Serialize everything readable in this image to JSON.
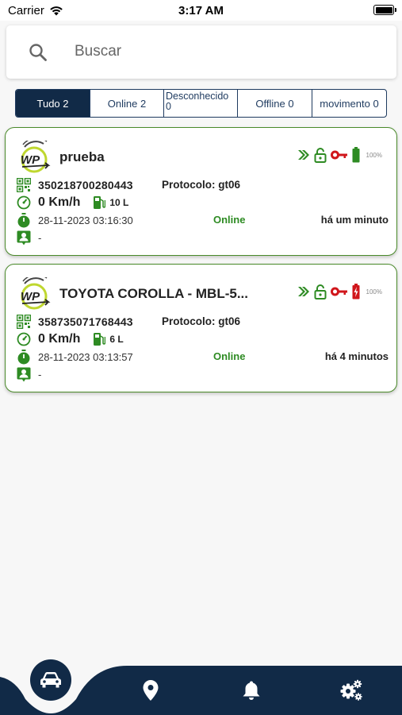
{
  "status_bar": {
    "carrier": "Carrier",
    "time": "3:17 AM"
  },
  "search": {
    "placeholder": "Buscar"
  },
  "filters": [
    {
      "label": "Tudo 2",
      "active": true
    },
    {
      "label": "Online 2",
      "active": false
    },
    {
      "label": "Desconhecido 0",
      "active": false
    },
    {
      "label": "Offline 0",
      "active": false
    },
    {
      "label": "movimento 0",
      "active": false
    }
  ],
  "vehicles": [
    {
      "name": "prueba",
      "imei": "350218700280443",
      "protocol": "Protocolo: gt06",
      "speed": "0 Km/h",
      "fuel": "10 L",
      "datetime": "28-11-2023 03:16:30",
      "status": "Online",
      "ago": "há um minuto",
      "driver": "-",
      "battery_pct": "100%",
      "battery_color": "#2e8b23"
    },
    {
      "name": "TOYOTA COROLLA - MBL-5...",
      "imei": "358735071768443",
      "protocol": "Protocolo: gt06",
      "speed": "0 Km/h",
      "fuel": "6 L",
      "datetime": "28-11-2023 03:13:57",
      "status": "Online",
      "ago": "há 4 minutos",
      "driver": "-",
      "battery_pct": "100%",
      "battery_color": "#d0161b"
    }
  ],
  "colors": {
    "brand_navy": "#112a47",
    "accent_green": "#2e8b23",
    "alert_red": "#d0161b"
  },
  "nav": {
    "items": [
      "car-icon",
      "map-pin-icon",
      "bell-icon",
      "settings-icon"
    ],
    "active": "car-icon"
  }
}
